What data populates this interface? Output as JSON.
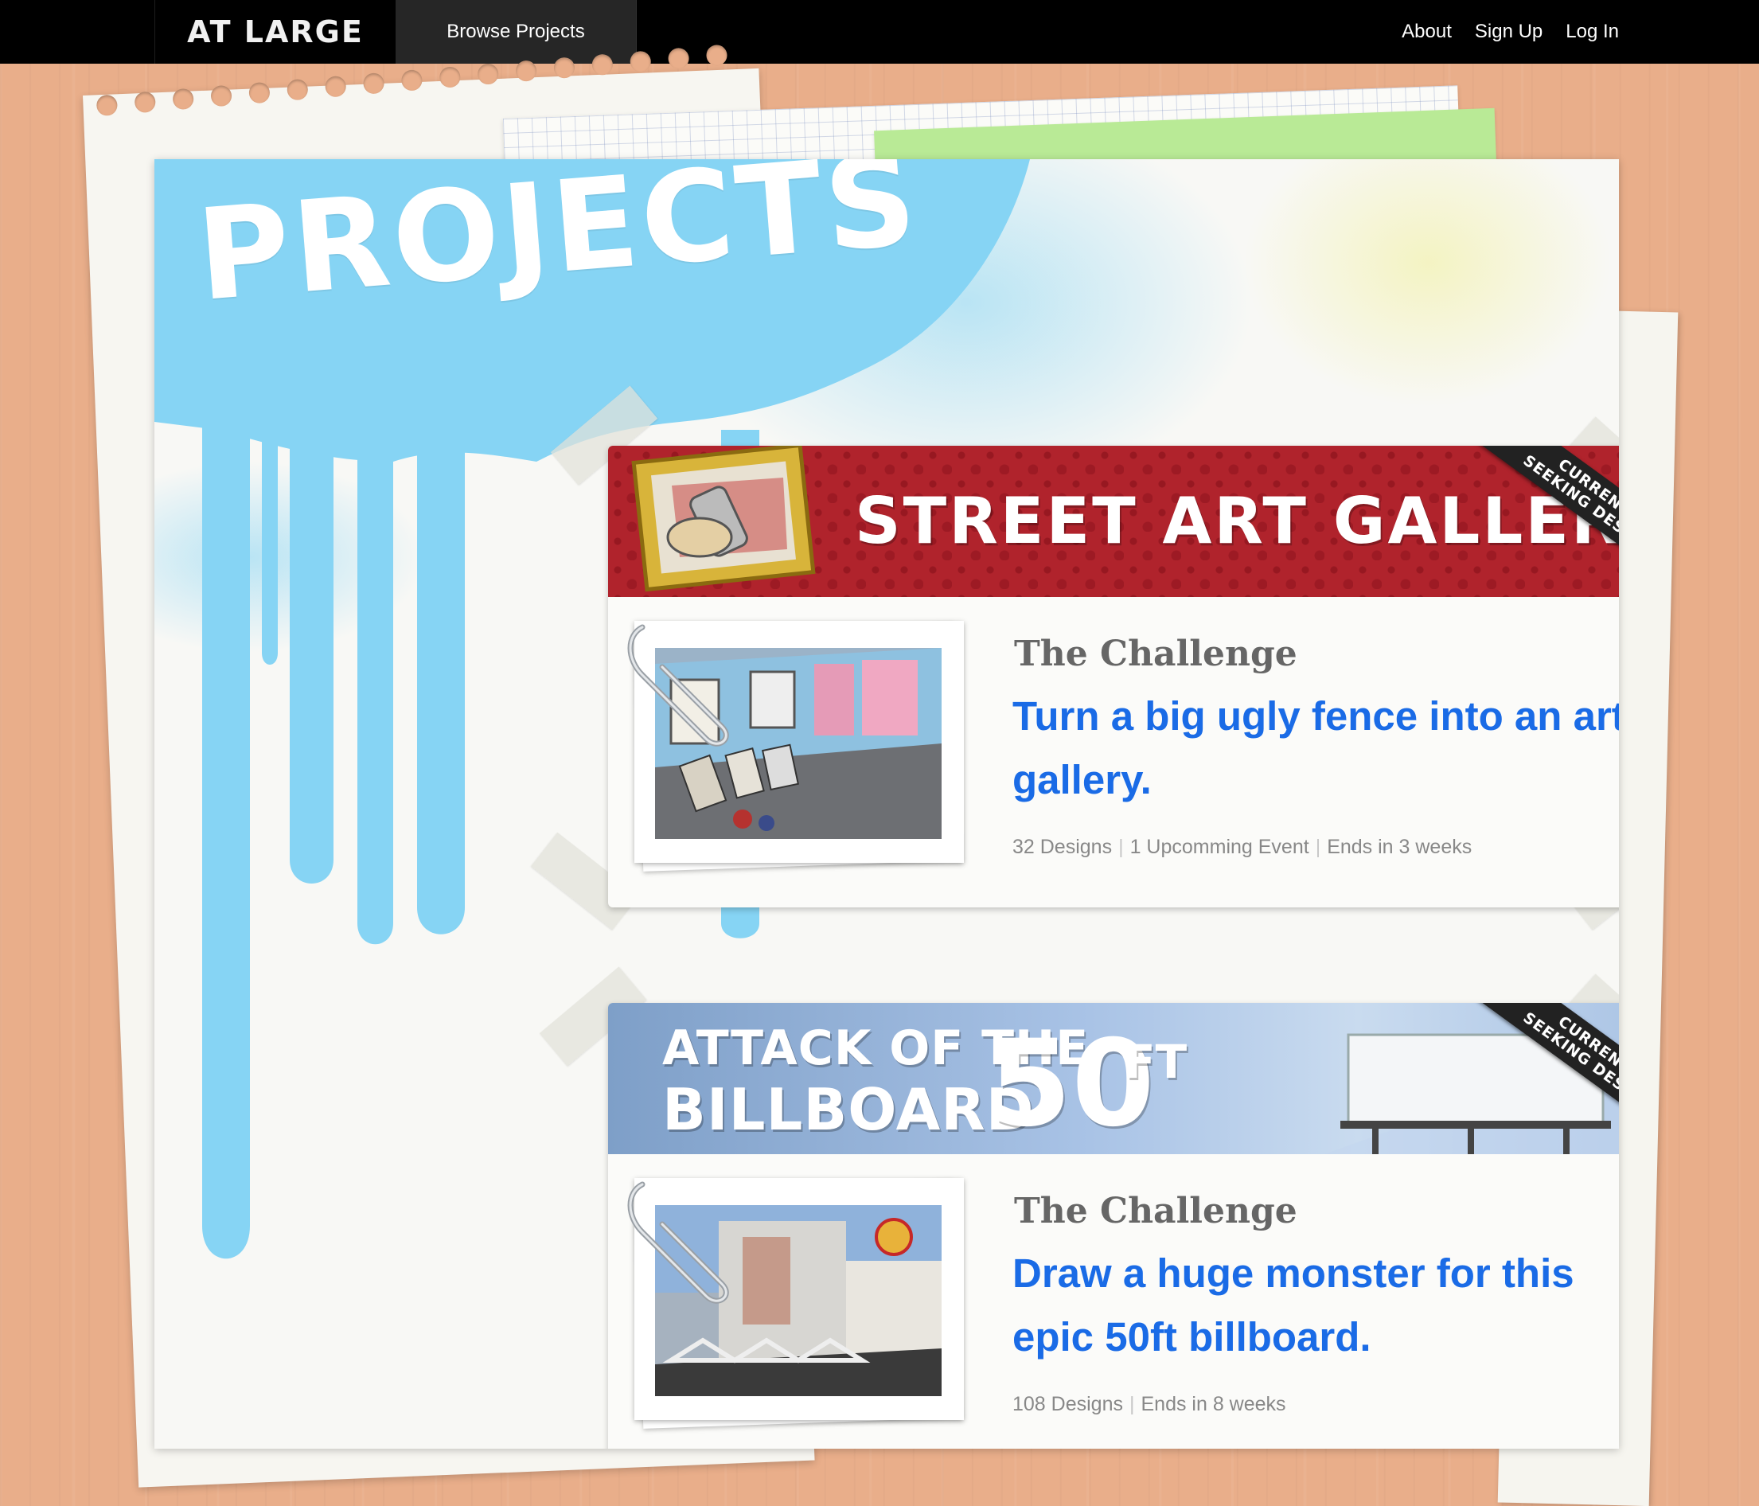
{
  "nav": {
    "brand": "AT LARGE",
    "browse_projects": "Browse Projects",
    "about": "About",
    "sign_up": "Sign Up",
    "log_in": "Log In"
  },
  "page": {
    "title": "PROJECTS"
  },
  "projects": [
    {
      "banner_title": "STREET ART GALLERY",
      "ribbon_line1": "CURRENTLY",
      "ribbon_line2": "SEEKING DESIGNS",
      "challenge_label": "The Challenge",
      "challenge_title": "Turn a big ugly fence into an art gallery.",
      "stats": [
        "32 Designs",
        "1 Upcomming Event",
        "Ends in 3 weeks"
      ]
    },
    {
      "banner_line1": "ATTACK OF THE",
      "banner_line2": "BILLBOARD",
      "banner_big": "50",
      "banner_unit": "FT",
      "ribbon_line1": "CURRENTLY",
      "ribbon_line2": "SEEKING DESIGNS",
      "challenge_label": "The Challenge",
      "challenge_title": "Draw a huge monster for this epic 50ft billboard.",
      "stats": [
        "108 Designs",
        "Ends in 8 weeks"
      ]
    }
  ],
  "colors": {
    "background": "#e9ae8a",
    "paint_blue": "#86d4f4",
    "link_blue": "#1a6be6",
    "banner_red": "#b0232c",
    "banner_blue": "#a9c3e6"
  }
}
